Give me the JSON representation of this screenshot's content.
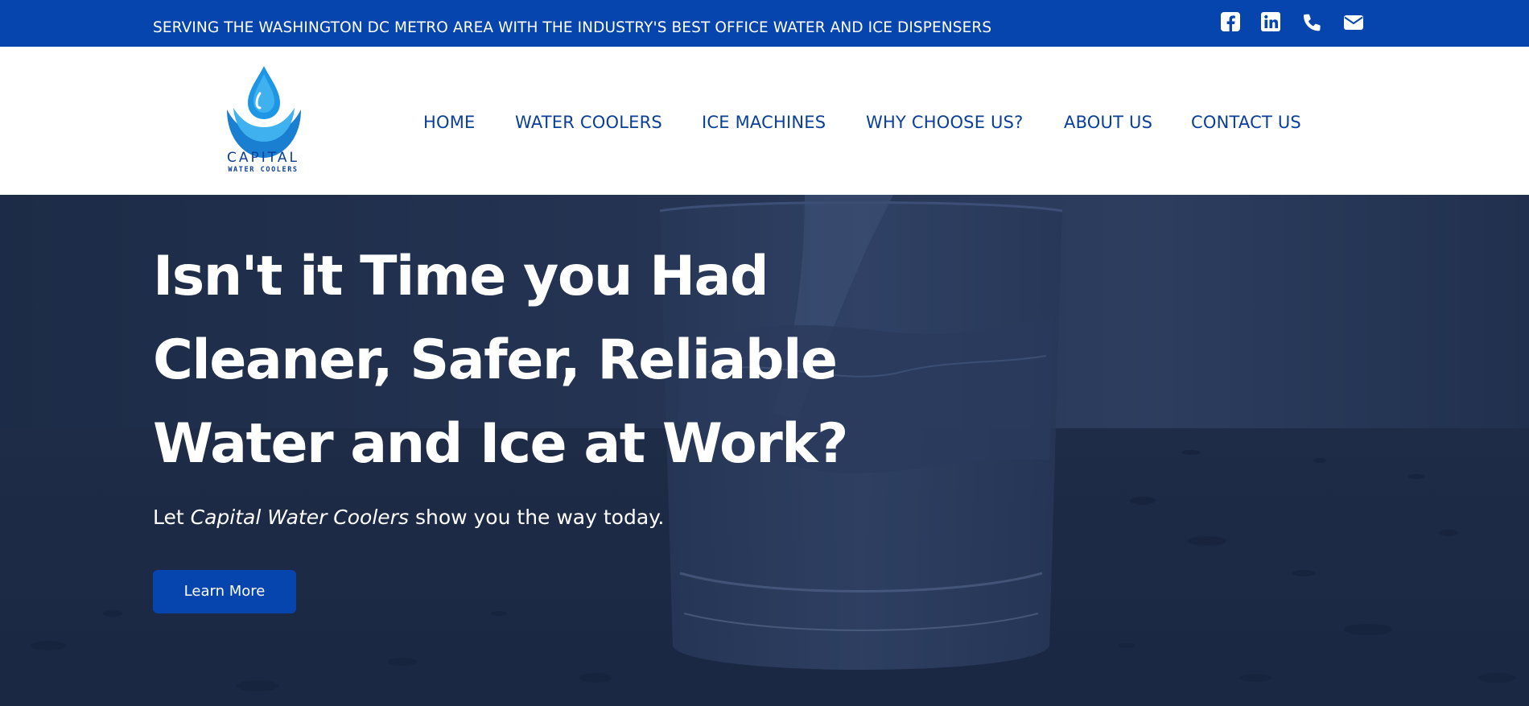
{
  "topbar": {
    "tagline": "SERVING THE WASHINGTON DC METRO AREA WITH THE INDUSTRY'S BEST OFFICE WATER AND ICE DISPENSERS",
    "social": [
      "facebook-icon",
      "linkedin-icon",
      "phone-icon",
      "email-icon"
    ]
  },
  "logo": {
    "name": "CAPITAL",
    "sub": "WATER COOLERS"
  },
  "nav": {
    "items": [
      "HOME",
      "WATER COOLERS",
      "ICE MACHINES",
      "WHY CHOOSE US?",
      "ABOUT US",
      "CONTACT US"
    ]
  },
  "hero": {
    "title_lines": [
      "Isn't it Time you Had",
      "Cleaner, Safer, Reliable",
      "Water and Ice at Work?"
    ],
    "sub_prefix": "Let ",
    "sub_brand": "Capital Water Coolers",
    "sub_suffix": " show you the way today.",
    "cta": "Learn More"
  },
  "colors": {
    "brand_blue": "#0645ad",
    "nav_text": "#0a3f99",
    "hero_overlay": "#1f2d4a",
    "logo_light": "#3fb1ef",
    "logo_dark": "#1a7fd0"
  }
}
